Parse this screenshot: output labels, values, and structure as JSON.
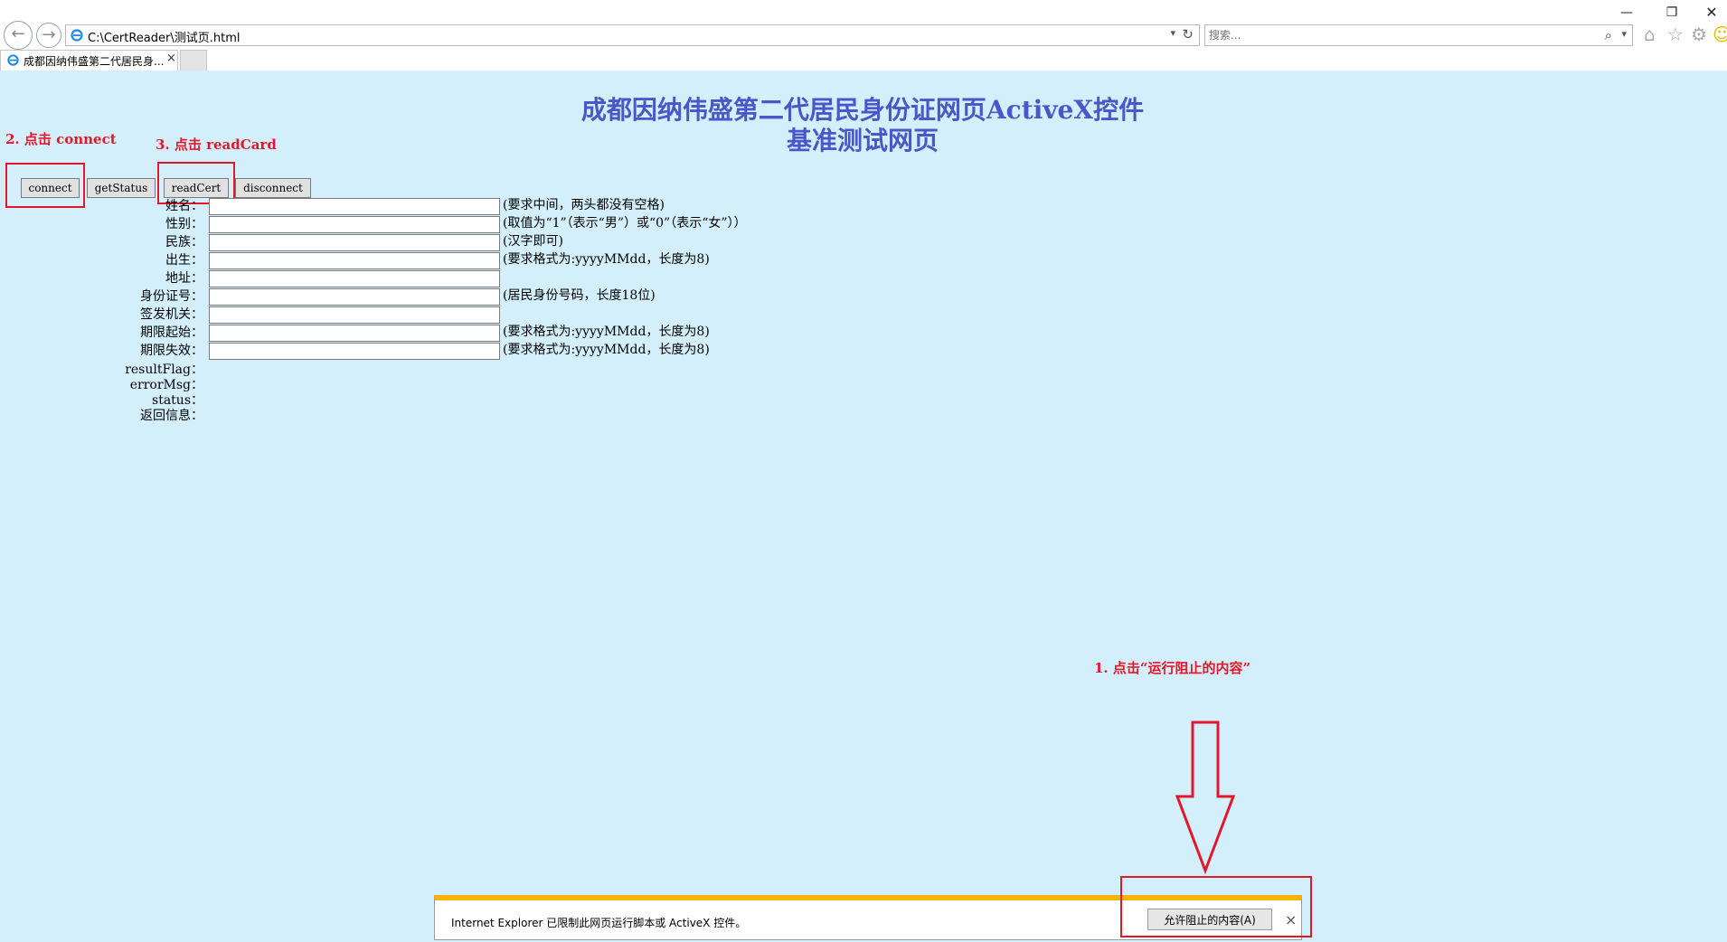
{
  "browser": {
    "address": "C:\\CertReader\\测试页.html",
    "search_placeholder": "搜索...",
    "tab_title": "成都因纳伟盛第二代居民身...",
    "tab_close": "×",
    "minimize": "—",
    "restore": "❐",
    "close": "✕"
  },
  "page": {
    "title_line1": "成都因纳伟盛第二代居民身份证网页ActiveX控件",
    "title_line2": "基准测试网页"
  },
  "annotations": {
    "step1": "1. 点击“运行阻止的内容”",
    "step2": "2. 点击 connect",
    "step3": "3. 点击 readCard"
  },
  "buttons": {
    "connect": "connect",
    "getStatus": "getStatus",
    "readCert": "readCert",
    "disconnect": "disconnect"
  },
  "fields": [
    {
      "label": "姓名：",
      "hint": "(要求中间，两头都没有空格)",
      "value": ""
    },
    {
      "label": "性别：",
      "hint": "(取值为“1”（表示“男”）或“0”（表示“女”））",
      "value": ""
    },
    {
      "label": "民族：",
      "hint": "(汉字即可)",
      "value": ""
    },
    {
      "label": "出生：",
      "hint": "(要求格式为:yyyyMMdd，长度为8)",
      "value": ""
    },
    {
      "label": "地址：",
      "hint": "",
      "value": ""
    },
    {
      "label": "身份证号：",
      "hint": "(居民身份号码，长度18位)",
      "value": ""
    },
    {
      "label": "签发机关：",
      "hint": "",
      "value": ""
    },
    {
      "label": "期限起始：",
      "hint": "(要求格式为:yyyyMMdd，长度为8)",
      "value": ""
    },
    {
      "label": "期限失效：",
      "hint": "(要求格式为:yyyyMMdd，长度为8)",
      "value": ""
    }
  ],
  "outputs": [
    {
      "label": "resultFlag："
    },
    {
      "label": "errorMsg："
    },
    {
      "label": "status："
    },
    {
      "label": "返回信息："
    }
  ],
  "notification": {
    "message": "Internet Explorer 已限制此网页运行脚本或 ActiveX 控件。",
    "allow_button": "允许阻止的内容(A)",
    "close": "×"
  },
  "colors": {
    "page_background": "#d4effc",
    "title": "#4a57c8",
    "annotation": "#e2172a",
    "notification_accent": "#f5b400"
  }
}
